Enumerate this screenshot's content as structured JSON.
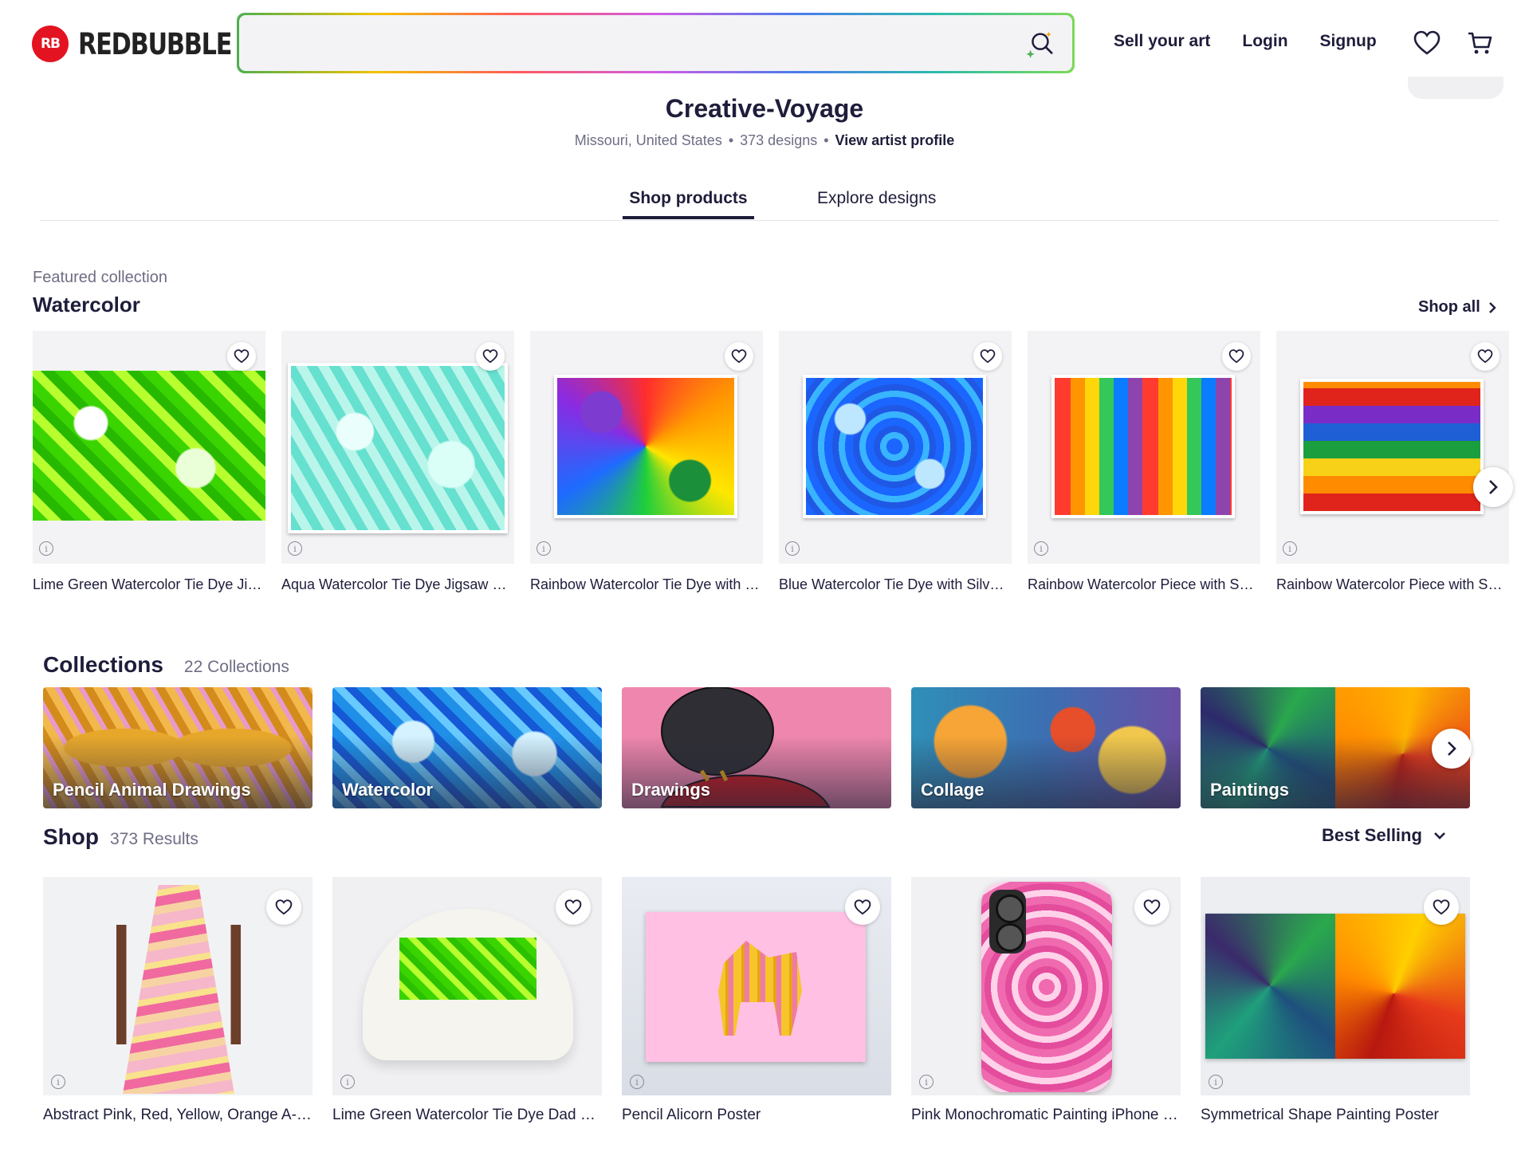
{
  "header": {
    "logo_mark": "RB",
    "logo_text": "REDBUBBLE",
    "search_placeholder": "",
    "nav": {
      "sell": "Sell your art",
      "login": "Login",
      "signup": "Signup"
    }
  },
  "artist": {
    "name": "Creative-Voyage",
    "location": "Missouri, United States",
    "designs": "373 designs",
    "profile_link": "View artist profile",
    "tabs": {
      "active": "Shop products",
      "inactive": "Explore designs"
    }
  },
  "featured": {
    "subtitle": "Featured collection",
    "title": "Watercolor",
    "shop_all": "Shop all",
    "items": [
      {
        "label": "Lime Green Watercolor Tie Dye Jigsaw Puzzle",
        "art": "lime"
      },
      {
        "label": "Aqua Watercolor Tie Dye Jigsaw Puzzle",
        "art": "aqua"
      },
      {
        "label": "Rainbow Watercolor Tie Dye with Silver Swirls",
        "art": "rainbow1"
      },
      {
        "label": "Blue Watercolor Tie Dye with Silver Swirls",
        "art": "blue"
      },
      {
        "label": "Rainbow Watercolor Piece with Symmetry",
        "art": "rainbow2"
      },
      {
        "label": "Rainbow Watercolor Piece with Symmetry",
        "art": "rainbow3"
      }
    ]
  },
  "collections": {
    "title": "Collections",
    "count": "22 Collections",
    "items": [
      {
        "label": "Pencil Animal Drawings"
      },
      {
        "label": "Watercolor"
      },
      {
        "label": "Drawings"
      },
      {
        "label": "Collage"
      },
      {
        "label": "Paintings"
      }
    ]
  },
  "shop": {
    "title": "Shop",
    "count": "373 Results",
    "sort_label": "Best Selling",
    "items": [
      {
        "label": "Abstract Pink, Red, Yellow, Orange A-Line Dress"
      },
      {
        "label": "Lime Green Watercolor Tie Dye Dad Hat"
      },
      {
        "label": "Pencil Alicorn Poster"
      },
      {
        "label": "Pink Monochromatic Painting iPhone Case"
      },
      {
        "label": "Symmetrical Shape Painting Poster"
      }
    ]
  },
  "icons": {
    "heart": "heart-icon",
    "cart": "cart-icon",
    "search": "sparkle-search-icon",
    "info": "info-icon",
    "chevron": "chevron-right-icon"
  },
  "colors": {
    "brand": "#e41321",
    "text": "#1e1d3b",
    "muted": "#6e6d85"
  }
}
